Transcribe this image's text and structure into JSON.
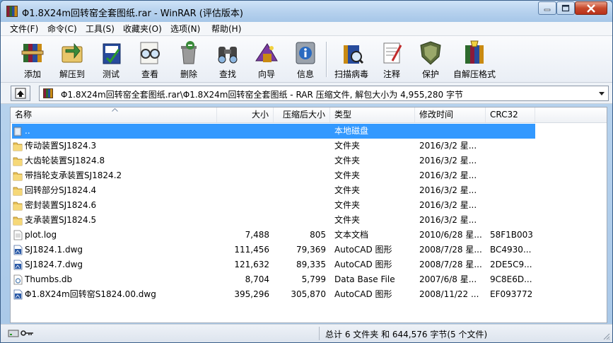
{
  "window": {
    "title": "Φ1.8X24m回转窑全套图纸.rar - WinRAR (评估版本)"
  },
  "menu": [
    "文件(F)",
    "命令(C)",
    "工具(S)",
    "收藏夹(O)",
    "选项(N)",
    "帮助(H)"
  ],
  "toolbar": [
    {
      "label": "添加",
      "icon": "add-archive-icon"
    },
    {
      "label": "解压到",
      "icon": "extract-to-icon"
    },
    {
      "label": "测试",
      "icon": "test-icon"
    },
    {
      "label": "查看",
      "icon": "view-icon"
    },
    {
      "label": "删除",
      "icon": "delete-icon"
    },
    {
      "label": "查找",
      "icon": "find-icon"
    },
    {
      "label": "向导",
      "icon": "wizard-icon"
    },
    {
      "label": "信息",
      "icon": "info-icon"
    },
    {
      "label": "扫描病毒",
      "icon": "virus-scan-icon"
    },
    {
      "label": "注释",
      "icon": "comment-icon"
    },
    {
      "label": "保护",
      "icon": "protect-icon"
    },
    {
      "label": "自解压格式",
      "icon": "sfx-icon"
    }
  ],
  "address": {
    "path": "Φ1.8X24m回转窑全套图纸.rar\\Φ1.8X24m回转窑全套图纸 - RAR 压缩文件, 解包大小为 4,955,280 字节"
  },
  "columns": [
    "名称",
    "大小",
    "压缩后大小",
    "类型",
    "修改时间",
    "CRC32"
  ],
  "files": [
    {
      "name": "..",
      "size": "",
      "packed": "",
      "type": "本地磁盘",
      "modified": "",
      "crc": "",
      "icon": "parent-folder-icon",
      "selected": true
    },
    {
      "name": "传动装置SJ1824.3",
      "size": "",
      "packed": "",
      "type": "文件夹",
      "modified": "2016/3/2 星...",
      "crc": "",
      "icon": "folder-icon"
    },
    {
      "name": "大齿轮装置SJ1824.8",
      "size": "",
      "packed": "",
      "type": "文件夹",
      "modified": "2016/3/2 星...",
      "crc": "",
      "icon": "folder-icon"
    },
    {
      "name": "带挡轮支承装置SJ1824.2",
      "size": "",
      "packed": "",
      "type": "文件夹",
      "modified": "2016/3/2 星...",
      "crc": "",
      "icon": "folder-icon"
    },
    {
      "name": "回转部分SJ1824.4",
      "size": "",
      "packed": "",
      "type": "文件夹",
      "modified": "2016/3/2 星...",
      "crc": "",
      "icon": "folder-icon"
    },
    {
      "name": "密封装置SJ1824.6",
      "size": "",
      "packed": "",
      "type": "文件夹",
      "modified": "2016/3/2 星...",
      "crc": "",
      "icon": "folder-icon"
    },
    {
      "name": "支承装置SJ1824.5",
      "size": "",
      "packed": "",
      "type": "文件夹",
      "modified": "2016/3/2 星...",
      "crc": "",
      "icon": "folder-icon"
    },
    {
      "name": "plot.log",
      "size": "7,488",
      "packed": "805",
      "type": "文本文档",
      "modified": "2010/6/28 星...",
      "crc": "58F1B003",
      "icon": "text-file-icon"
    },
    {
      "name": "SJ1824.1.dwg",
      "size": "111,456",
      "packed": "79,369",
      "type": "AutoCAD 图形",
      "modified": "2008/7/28 星...",
      "crc": "BC4930...",
      "icon": "dwg-file-icon"
    },
    {
      "name": "SJ1824.7.dwg",
      "size": "121,632",
      "packed": "89,335",
      "type": "AutoCAD 图形",
      "modified": "2008/7/28 星...",
      "crc": "2DE5C9...",
      "icon": "dwg-file-icon"
    },
    {
      "name": "Thumbs.db",
      "size": "8,704",
      "packed": "5,799",
      "type": "Data Base File",
      "modified": "2007/6/8 星...",
      "crc": "9C8E6D...",
      "icon": "db-file-icon"
    },
    {
      "name": "Φ1.8X24m回转窑S1824.00.dwg",
      "size": "395,296",
      "packed": "305,870",
      "type": "AutoCAD 图形",
      "modified": "2008/11/22 ...",
      "crc": "EF093772",
      "icon": "dwg-file-icon"
    }
  ],
  "status": {
    "text": "总计 6 文件夹 和 644,576 字节(5 个文件)"
  }
}
